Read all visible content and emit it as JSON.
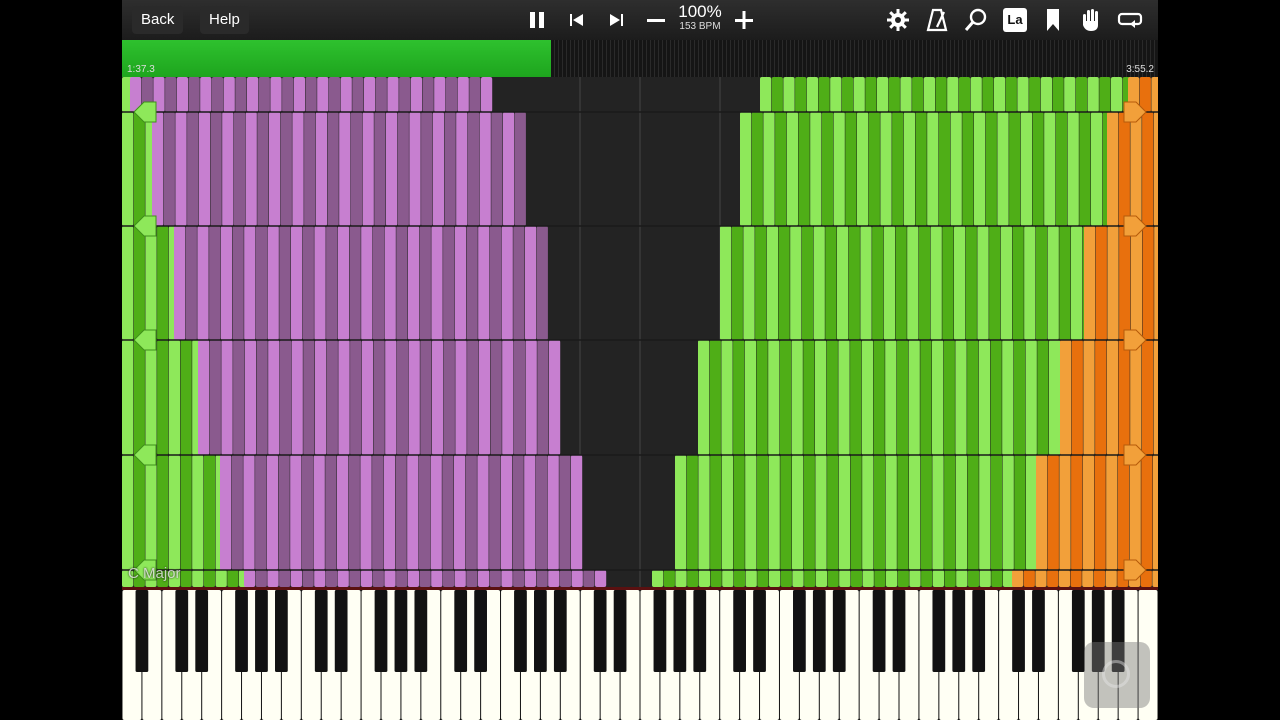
{
  "toolbar": {
    "back_label": "Back",
    "help_label": "Help",
    "tempo_percent": "100%",
    "tempo_bpm": "153 BPM",
    "icons": [
      "pause-icon",
      "skip-back-icon",
      "skip-forward-icon",
      "minus-icon",
      "plus-icon",
      "gear-icon",
      "metronome-icon",
      "search-icon",
      "note-label-icon",
      "bookmark-icon",
      "hand-icon",
      "loop-icon"
    ],
    "note_label_text": "La"
  },
  "progress": {
    "current_time": "1:37.3",
    "total_time": "3:55.2",
    "fraction": 0.414
  },
  "roll": {
    "key_label": "C Major",
    "colors": {
      "purple_light": "#c77fd0",
      "purple_dark": "#8a5a8e",
      "green_light": "#8ee85a",
      "green_dark": "#4fae17",
      "orange_light": "#f2a03a",
      "orange_dark": "#e8700d",
      "background": "#232323"
    }
  },
  "keyboard": {
    "white_key_color": "#fffff4",
    "black_key_color": "#121212"
  }
}
